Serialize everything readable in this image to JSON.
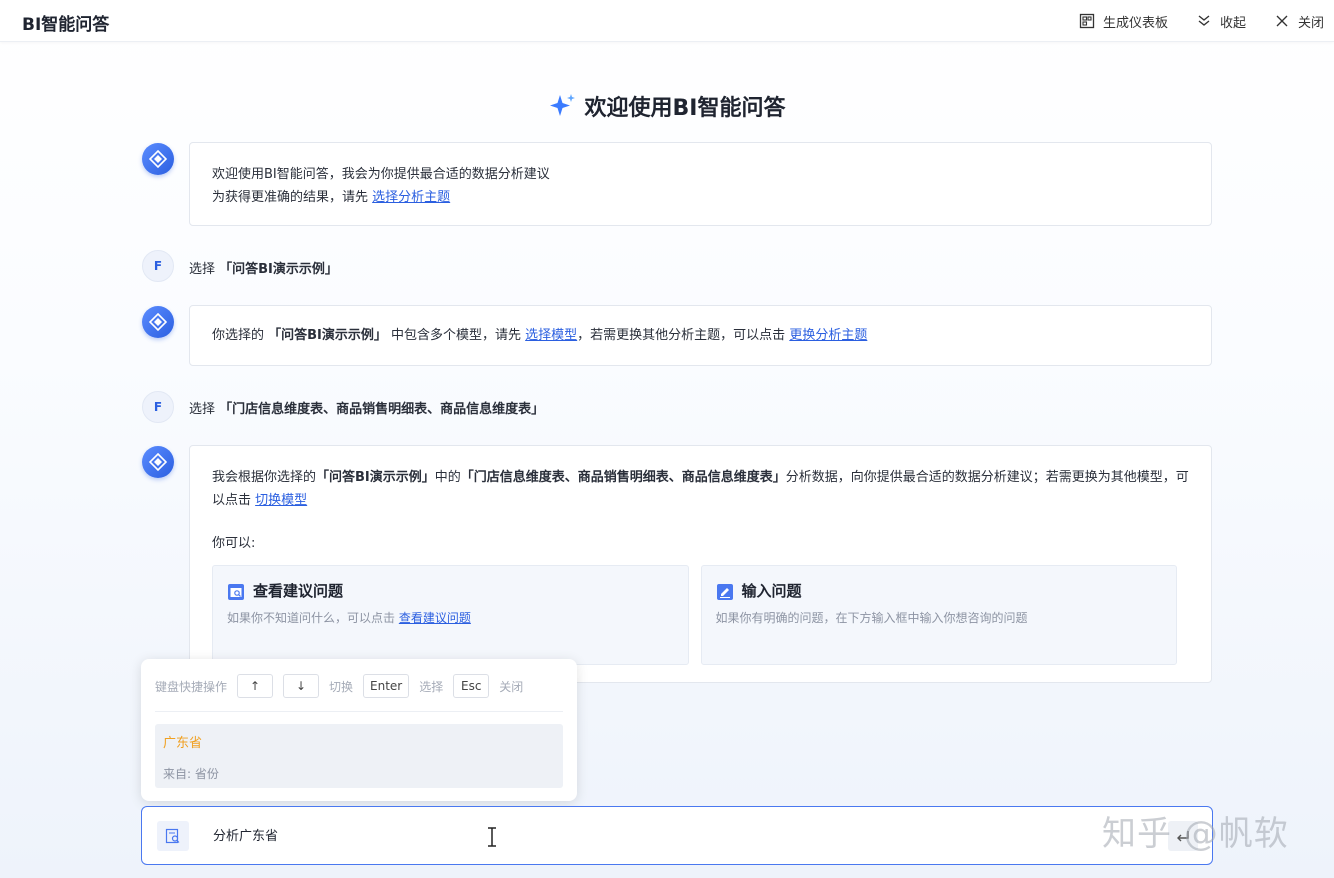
{
  "header": {
    "title": "BI智能问答",
    "actions": [
      {
        "label": "生成仪表板",
        "icon": "dashboard-icon"
      },
      {
        "label": "收起",
        "icon": "collapse-icon"
      },
      {
        "label": "关闭",
        "icon": "close-icon"
      }
    ]
  },
  "welcome_title": "欢迎使用BI智能问答",
  "messages": {
    "m1": {
      "line1": "欢迎使用BI智能问答，我会为你提供最合适的数据分析建议",
      "line2_prefix": "为获得更准确的结果，请先 ",
      "line2_link": "选择分析主题"
    },
    "u1": {
      "avatar": "F",
      "prefix": "选择 ",
      "value": "「问答BI演示示例」"
    },
    "m2": {
      "prefix": "你选择的 ",
      "bold": "「问答BI演示示例」",
      "mid": " 中包含多个模型，请先 ",
      "link1": "选择模型",
      "mid2": "，若需更换其他分析主题，可以点击 ",
      "link2": "更换分析主题"
    },
    "u2": {
      "avatar": "F",
      "prefix": "选择 ",
      "value": "「门店信息维度表、商品销售明细表、商品信息维度表」"
    },
    "m3": {
      "t1": "我会根据你选择的",
      "b1": "「问答BI演示示例」",
      "t2": "中的",
      "b2": "「门店信息维度表、商品销售明细表、商品信息维度表」",
      "t3": "分析数据，向你提供最合适的数据分析建议；若需更换为其他模型，可以点击 ",
      "link": "切换模型",
      "you_can": "你可以:",
      "card1_title": "查看建议问题",
      "card1_desc": "如果你不知道问什么，可以点击 ",
      "card1_link": "查看建议问题",
      "card2_title": "输入问题",
      "card2_desc": "如果你有明确的问题，在下方输入框中输入你想咨询的问题"
    }
  },
  "popup": {
    "shortcut_label": "键盘快捷操作",
    "up_key": "↑",
    "down_key": "↓",
    "switch_label": "切换",
    "enter_key": "Enter",
    "select_label": "选择",
    "esc_key": "Esc",
    "close_label": "关闭",
    "suggestion_title": "广东省",
    "suggestion_source": "来自: 省份"
  },
  "input": {
    "value": "分析广东省"
  },
  "watermark": "知乎 @帆软",
  "colors": {
    "accent": "#2b5fe0",
    "highlight": "#f0a020"
  }
}
